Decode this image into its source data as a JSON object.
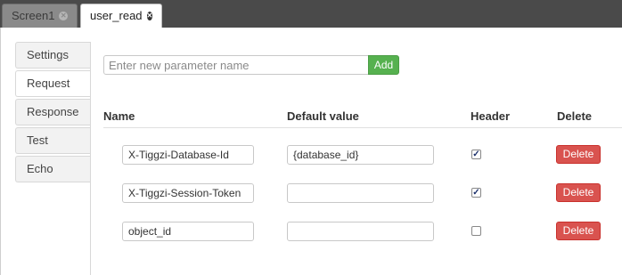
{
  "tabs": [
    {
      "label": "Screen1",
      "close_icon": "close-circle-icon"
    },
    {
      "label": "user_read",
      "close_icon": "close-circle-icon"
    }
  ],
  "sidebar": {
    "items": [
      "Settings",
      "Request",
      "Response",
      "Test",
      "Echo"
    ],
    "active": "Request"
  },
  "new_param": {
    "placeholder": "Enter new parameter name",
    "add_label": "Add"
  },
  "table": {
    "headers": {
      "name": "Name",
      "default": "Default value",
      "header": "Header",
      "delete": "Delete"
    },
    "rows": [
      {
        "name": "X-Tiggzi-Database-Id",
        "default": "{database_id}",
        "header": true,
        "delete_label": "Delete"
      },
      {
        "name": "X-Tiggzi-Session-Token",
        "default": "",
        "header": true,
        "delete_label": "Delete"
      },
      {
        "name": "object_id",
        "default": "",
        "header": false,
        "delete_label": "Delete"
      }
    ]
  },
  "colors": {
    "add": "#56b14f",
    "delete": "#d9534f",
    "tabbar": "#4a4a4a"
  }
}
